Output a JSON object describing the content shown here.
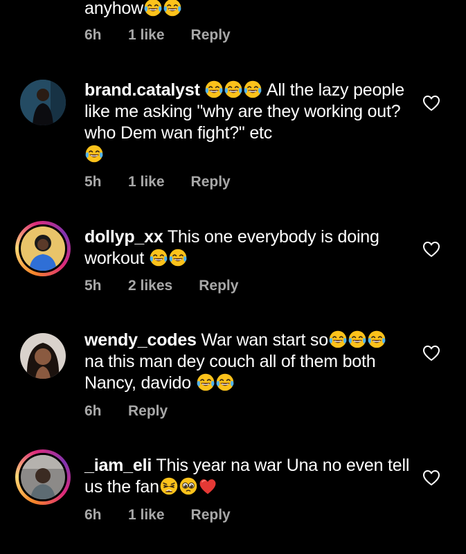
{
  "comments": [
    {
      "text_tail": "anyhow",
      "emojis": [
        "laugh",
        "laugh"
      ],
      "time": "6h",
      "likes": "1 like",
      "reply": "Reply"
    },
    {
      "username": "brand.catalyst",
      "emojis_lead": [
        "laugh",
        "laugh",
        "laugh"
      ],
      "text": "All the lazy people like me asking \"why are they working out? who Dem wan fight?\" etc",
      "emojis_trail": [
        "laugh"
      ],
      "time": "5h",
      "likes": "1 like",
      "reply": "Reply"
    },
    {
      "username": "dollyp_xx",
      "text": "This one everybody is doing workout",
      "emojis_trail": [
        "laugh",
        "laugh"
      ],
      "time": "5h",
      "likes": "2 likes",
      "reply": "Reply"
    },
    {
      "username": "wendy_codes",
      "text_a": "War wan start so",
      "emojis_mid": [
        "laugh",
        "laugh",
        "laugh"
      ],
      "text_b": "na this man dey couch all of them both Nancy, davido",
      "emojis_trail": [
        "laugh",
        "laugh"
      ],
      "time": "6h",
      "reply": "Reply"
    },
    {
      "username": "_iam_eli",
      "text": "This year na war Una no even tell us the fan",
      "emojis_trail": [
        "weary",
        "pleading",
        "red-heart"
      ],
      "time": "6h",
      "likes": "1 like",
      "reply": "Reply"
    }
  ],
  "colors": {
    "background": "#000000",
    "text": "#ffffff",
    "meta": "#a8a8a8"
  },
  "icons": [
    "heart-outline-icon",
    "laughing-emoji",
    "weary-emoji",
    "pleading-emoji",
    "red-heart-emoji"
  ]
}
